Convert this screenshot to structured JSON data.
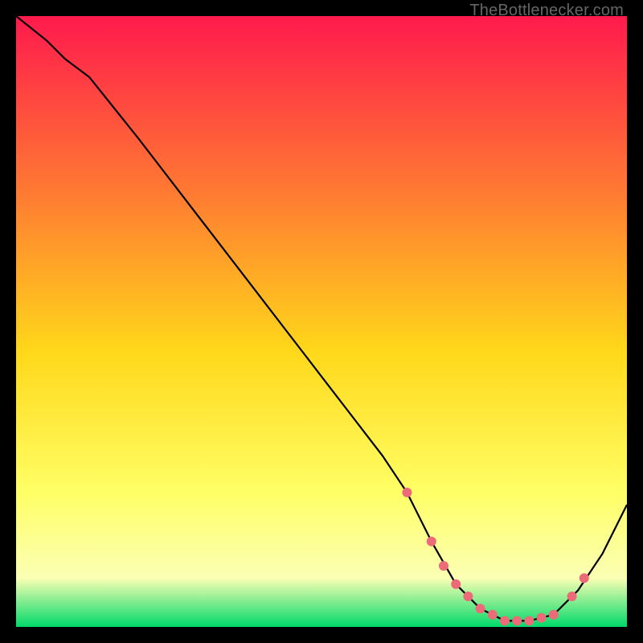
{
  "watermark": "TheBottlenecker.com",
  "colors": {
    "gradient_top": "#ff1a4d",
    "gradient_mid1": "#ff7733",
    "gradient_mid2": "#ffd81a",
    "gradient_mid3": "#ffff66",
    "gradient_mid4": "#fbffb3",
    "gradient_bottom": "#00d96a",
    "curve": "#000000",
    "marker": "#ed6a79",
    "frame": "#000000"
  },
  "chart_data": {
    "type": "line",
    "title": "",
    "xlabel": "",
    "ylabel": "",
    "xlim": [
      0,
      100
    ],
    "ylim": [
      0,
      100
    ],
    "series": [
      {
        "name": "curve",
        "x": [
          0,
          5,
          8,
          12,
          20,
          30,
          40,
          50,
          60,
          64,
          68,
          72,
          76,
          80,
          84,
          88,
          92,
          96,
          100
        ],
        "y": [
          100,
          96,
          93,
          90,
          80,
          67,
          54,
          41,
          28,
          22,
          14,
          7,
          3,
          1,
          1,
          2,
          6,
          12,
          20
        ]
      }
    ],
    "markers": {
      "name": "highlight-dots",
      "x": [
        64,
        68,
        70,
        72,
        74,
        76,
        78,
        80,
        82,
        84,
        86,
        88,
        91,
        93
      ],
      "y": [
        22,
        14,
        10,
        7,
        5,
        3,
        2,
        1,
        1,
        1,
        1.5,
        2,
        5,
        8
      ]
    }
  }
}
